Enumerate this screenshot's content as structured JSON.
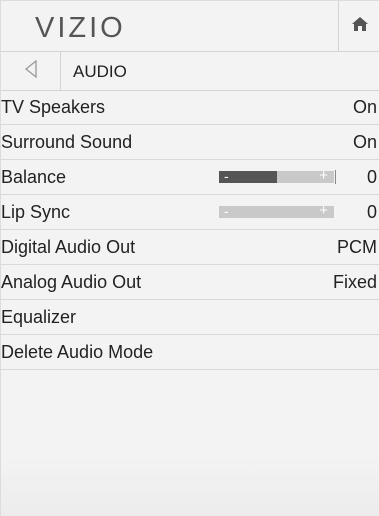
{
  "header": {
    "logo": "VIZIO",
    "home_icon": "home-icon"
  },
  "subheader": {
    "back_icon": "back-triangle-icon",
    "title": "AUDIO"
  },
  "menu": {
    "items": [
      {
        "label": "TV Speakers",
        "value": "On"
      },
      {
        "label": "Surround Sound",
        "value": "On"
      },
      {
        "label": "Balance",
        "value": "0",
        "slider_level": 0.5,
        "minus": "-",
        "plus": "+"
      },
      {
        "label": "Lip Sync",
        "value": "0",
        "slider_level": 0.0,
        "minus": "-",
        "plus": "+"
      },
      {
        "label": "Digital Audio Out",
        "value": "PCM"
      },
      {
        "label": "Analog Audio Out",
        "value": "Fixed"
      },
      {
        "label": "Equalizer"
      },
      {
        "label": "Delete Audio Mode"
      }
    ]
  },
  "colors": {
    "panel_bg": "#f3f3f3",
    "slider_track": "#c9c9c9",
    "slider_fill": "#555555"
  }
}
